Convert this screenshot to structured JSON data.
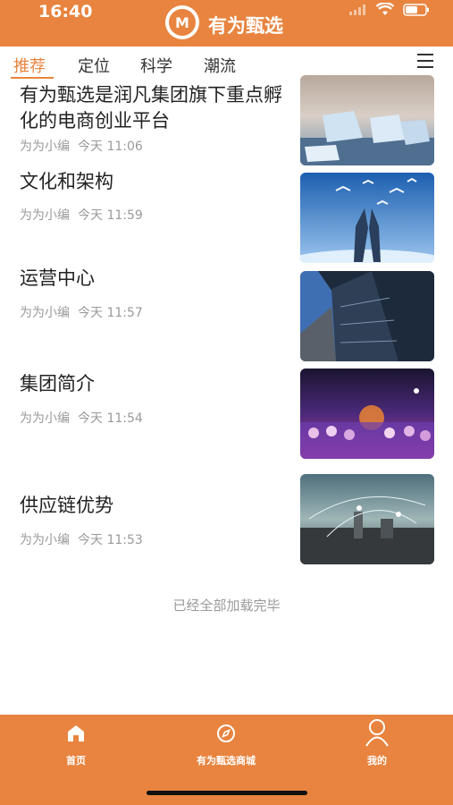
{
  "status_bar": {
    "time": "16:40"
  },
  "header": {
    "logo_text": "M",
    "title": "有为甄选"
  },
  "tabs": [
    {
      "label": "推荐",
      "active": true
    },
    {
      "label": "定位",
      "active": false
    },
    {
      "label": "科学",
      "active": false
    },
    {
      "label": "潮流",
      "active": false
    }
  ],
  "articles": [
    {
      "title": "有为甄选是润凡集团旗下重点孵化的电商创业平台",
      "author": "为为小编",
      "time": "今天 11:06",
      "image": "ice-blocks-photo"
    },
    {
      "title": "文化和架构",
      "author": "为为小编",
      "time": "今天 11:59",
      "image": "hands-birds-photo"
    },
    {
      "title": "运营中心",
      "author": "为为小编",
      "time": "今天 11:57",
      "image": "skyscraper-photo"
    },
    {
      "title": "集团简介",
      "author": "为为小编",
      "time": "今天 11:54",
      "image": "crowd-party-photo"
    },
    {
      "title": "供应链优势",
      "author": "为为小编",
      "time": "今天 11:53",
      "image": "city-network-photo"
    }
  ],
  "footer_note": "已经全部加载完毕",
  "bottom_nav": [
    {
      "label": "首页",
      "icon": "home-icon"
    },
    {
      "label": "有为甄选商城",
      "icon": "compass-icon"
    },
    {
      "label": "我的",
      "icon": "user-icon"
    }
  ],
  "colors": {
    "brand": "#E8843F",
    "text": "#222222",
    "meta": "#9a9a9a"
  }
}
